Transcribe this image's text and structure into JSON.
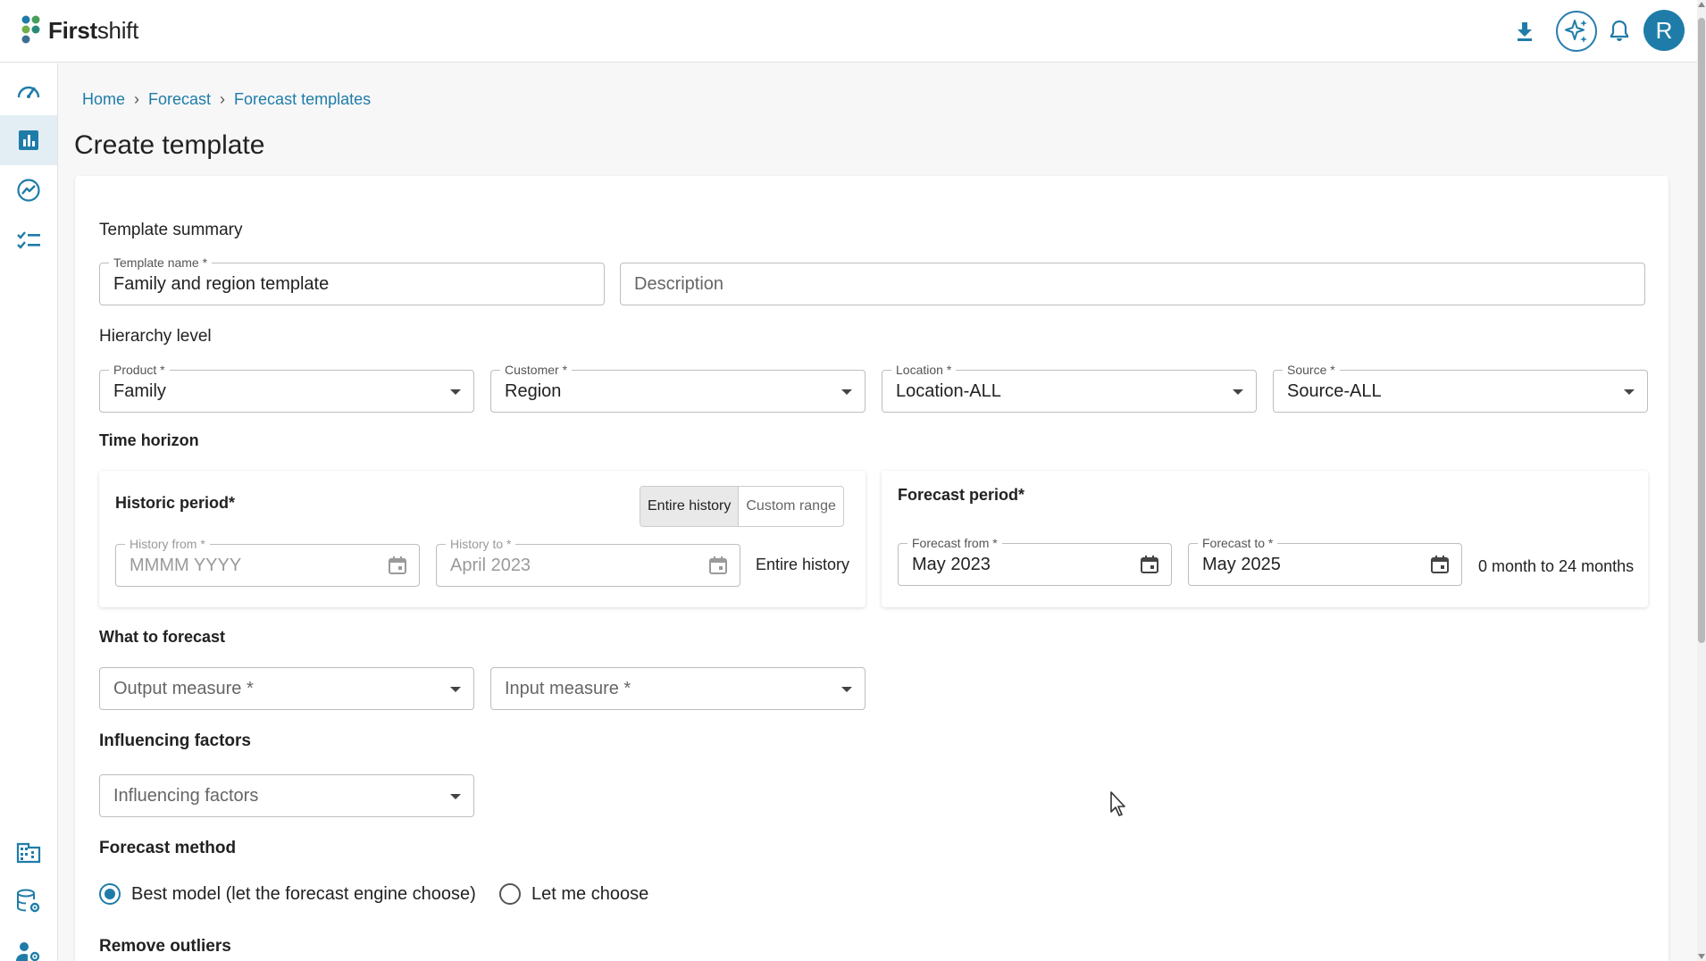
{
  "app": {
    "logo_bold": "First",
    "logo_rest": "shift",
    "avatar_initial": "R",
    "accent_color": "#1f7ca8"
  },
  "topbar": {
    "icons": [
      "download-icon",
      "ai-sparkle-icon",
      "bell-icon"
    ]
  },
  "sidebar": {
    "items": [
      {
        "icon": "dashboard-gauge-icon",
        "active": false
      },
      {
        "icon": "bar-chart-icon",
        "active": true
      },
      {
        "icon": "trend-chart-icon",
        "active": false
      },
      {
        "icon": "checklist-icon",
        "active": false
      },
      {
        "icon": "building-icon",
        "active": false
      },
      {
        "icon": "database-settings-icon",
        "active": false
      },
      {
        "icon": "user-settings-icon",
        "active": false
      }
    ]
  },
  "breadcrumb": {
    "items": [
      "Home",
      "Forecast",
      "Forecast templates"
    ],
    "separator": "›"
  },
  "page": {
    "title": "Create template"
  },
  "template_summary": {
    "heading": "Template summary",
    "name_label": "Template name *",
    "name_value": "Family and region template",
    "description_placeholder": "Description"
  },
  "hierarchy": {
    "heading": "Hierarchy level",
    "product": {
      "label": "Product *",
      "value": "Family"
    },
    "customer": {
      "label": "Customer *",
      "value": "Region"
    },
    "location": {
      "label": "Location *",
      "value": "Location-ALL"
    },
    "source": {
      "label": "Source *",
      "value": "Source-ALL"
    }
  },
  "time_horizon": {
    "heading": "Time horizon",
    "historic": {
      "title": "Historic period*",
      "toggle_on": "Entire history",
      "toggle_off": "Custom range",
      "from_label": "History from *",
      "from_placeholder": "MMMM YYYY",
      "to_label": "History to *",
      "to_value": "April 2023",
      "summary": "Entire history"
    },
    "forecast": {
      "title": "Forecast period*",
      "from_label": "Forecast from *",
      "from_value": "May 2023",
      "to_label": "Forecast to *",
      "to_value": "May 2025",
      "summary": "0 month to 24 months"
    }
  },
  "what_to_forecast": {
    "heading": "What to forecast",
    "output_placeholder": "Output measure *",
    "input_placeholder": "Input measure *"
  },
  "influencing": {
    "heading": "Influencing factors",
    "placeholder": "Influencing factors"
  },
  "forecast_method": {
    "heading": "Forecast method",
    "options": [
      "Best model (let the forecast engine choose)",
      "Let me choose"
    ],
    "selected": 0
  },
  "remove_outliers": {
    "heading": "Remove outliers"
  }
}
